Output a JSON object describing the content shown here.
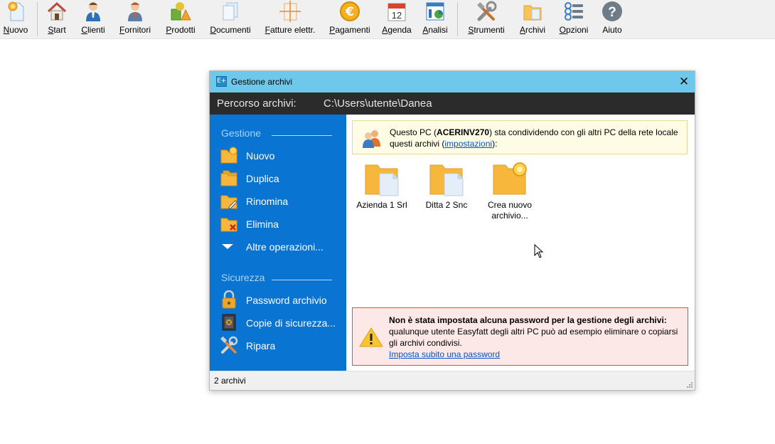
{
  "toolbar": {
    "items": [
      {
        "label": "Nuovo",
        "icon": "new-document-icon"
      },
      {
        "label": "Start",
        "icon": "home-icon"
      },
      {
        "label": "Clienti",
        "icon": "client-person-icon"
      },
      {
        "label": "Fornitori",
        "icon": "supplier-person-icon"
      },
      {
        "label": "Prodotti",
        "icon": "products-icon"
      },
      {
        "label": "Documenti",
        "icon": "documents-icon"
      },
      {
        "label": "Fatture elettr.",
        "icon": "e-invoice-icon"
      },
      {
        "label": "Pagamenti",
        "icon": "euro-coin-icon"
      },
      {
        "label": "Agenda",
        "icon": "calendar-icon",
        "day": "12"
      },
      {
        "label": "Analisi",
        "icon": "analysis-chart-icon"
      },
      {
        "label": "Strumenti",
        "icon": "tools-icon"
      },
      {
        "label": "Archivi",
        "icon": "archives-folder-icon"
      },
      {
        "label": "Opzioni",
        "icon": "options-list-icon"
      },
      {
        "label": "Aiuto",
        "icon": "help-question-icon",
        "glyph": "?"
      }
    ]
  },
  "dialog": {
    "app_icon": "E+",
    "title": "Gestione archivi",
    "close_glyph": "✕",
    "path_label": "Percorso archivi:",
    "path_value": "C:\\Users\\utente\\Danea",
    "sidebar": {
      "gestione_header": "Gestione",
      "gestione_items": [
        {
          "label": "Nuovo",
          "icon": "new-folder-icon"
        },
        {
          "label": "Duplica",
          "icon": "duplicate-folder-icon"
        },
        {
          "label": "Rinomina",
          "icon": "rename-folder-icon"
        },
        {
          "label": "Elimina",
          "icon": "delete-folder-icon"
        },
        {
          "label": "Altre operazioni...",
          "icon": "triangle-down-icon"
        }
      ],
      "sicurezza_header": "Sicurezza",
      "sicurezza_items": [
        {
          "label": "Password archivio",
          "icon": "padlock-icon"
        },
        {
          "label": "Copie di sicurezza...",
          "icon": "safe-icon"
        },
        {
          "label": "Ripara",
          "icon": "repair-tools-icon"
        }
      ]
    },
    "info": {
      "text_before": "Questo PC (",
      "pc_name": "ACERINV270",
      "text_middle": ") sta condividendo con gli altri PC della rete locale questi archivi (",
      "link": "impostazioni",
      "text_after": "):"
    },
    "archives": [
      {
        "label": "Azienda 1 Srl"
      },
      {
        "label": "Ditta 2 Snc"
      },
      {
        "label": "Crea nuovo archivio..."
      }
    ],
    "warning": {
      "bold": "Non è stata impostata alcuna password per la gestione degli archivi:",
      "text": " qualunque utente Easyfatt degli altri PC può ad esempio eliminare o copiarsi gli archivi condivisi.",
      "link": "Imposta subito una password"
    },
    "status": "2 archivi"
  },
  "colors": {
    "titlebar": "#6ec8ec",
    "pathbar": "#2b2b2b",
    "sidebar": "#0a74d2",
    "info_bg": "#fffce6",
    "warning_bg": "#fde8e8",
    "warning_border": "#e04b4b",
    "folder": "#f6b73c"
  }
}
